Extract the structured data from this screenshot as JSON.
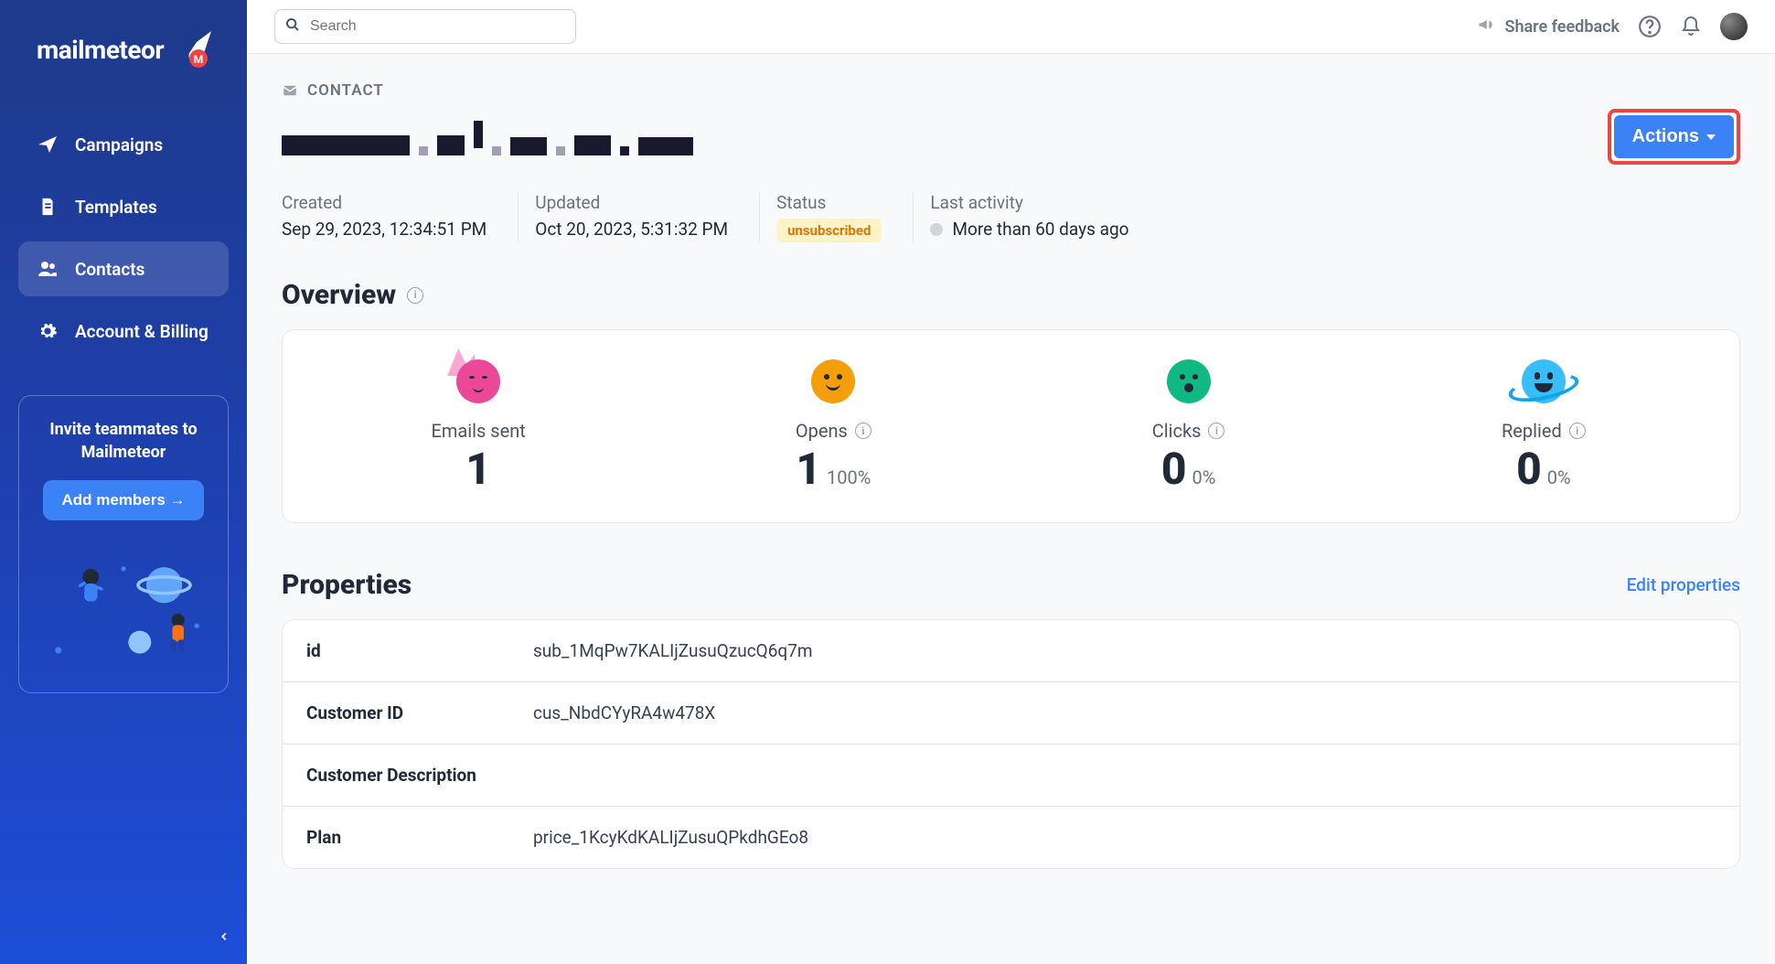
{
  "brand": {
    "name": "mailmeteor"
  },
  "sidebar": {
    "items": [
      {
        "label": "Campaigns"
      },
      {
        "label": "Templates"
      },
      {
        "label": "Contacts"
      },
      {
        "label": "Account & Billing"
      }
    ],
    "invite": {
      "title_line1": "Invite teammates to",
      "title_line2": "Mailmeteor",
      "button": "Add members →"
    }
  },
  "topbar": {
    "search_placeholder": "Search",
    "feedback": "Share feedback"
  },
  "page": {
    "breadcrumb": "CONTACT",
    "actions_label": "Actions",
    "meta": {
      "created_label": "Created",
      "created_value": "Sep 29, 2023, 12:34:51 PM",
      "updated_label": "Updated",
      "updated_value": "Oct 20, 2023, 5:31:32 PM",
      "status_label": "Status",
      "status_value": "unsubscribed",
      "activity_label": "Last activity",
      "activity_value": "More than 60 days ago"
    },
    "overview": {
      "title": "Overview",
      "stats": [
        {
          "label": "Emails sent",
          "value": "1",
          "pct": ""
        },
        {
          "label": "Opens",
          "value": "1",
          "pct": "100%"
        },
        {
          "label": "Clicks",
          "value": "0",
          "pct": "0%"
        },
        {
          "label": "Replied",
          "value": "0",
          "pct": "0%"
        }
      ]
    },
    "properties": {
      "title": "Properties",
      "edit_label": "Edit properties",
      "rows": [
        {
          "key": "id",
          "value": "sub_1MqPw7KALIjZusuQzucQ6q7m"
        },
        {
          "key": "Customer ID",
          "value": "cus_NbdCYyRA4w478X"
        },
        {
          "key": "Customer Description",
          "value": ""
        },
        {
          "key": "Plan",
          "value": "price_1KcyKdKALIjZusuQPkdhGEo8"
        }
      ]
    }
  }
}
